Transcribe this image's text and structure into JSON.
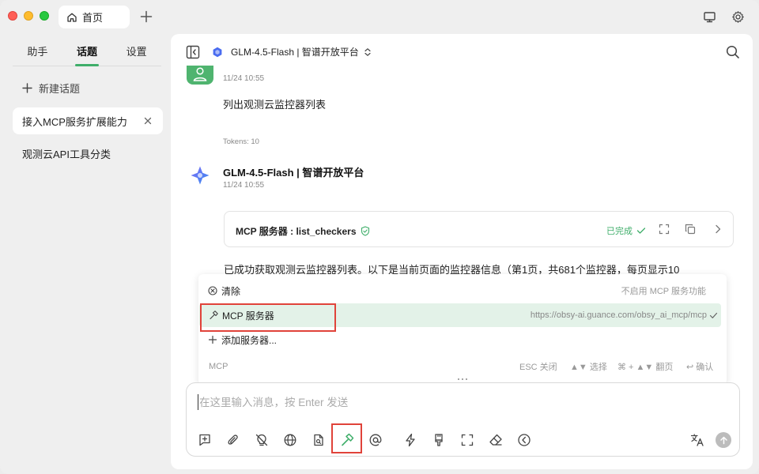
{
  "titlebar": {
    "tab_label": "首页"
  },
  "sidebar": {
    "tabs": [
      {
        "label": "助手"
      },
      {
        "label": "话题"
      },
      {
        "label": "设置"
      }
    ],
    "new_topic_label": "新建话题",
    "topics": [
      {
        "label": "接入MCP服务扩展能力"
      },
      {
        "label": "观测云API工具分类"
      }
    ]
  },
  "header": {
    "model_label": "GLM-4.5-Flash | 智谱开放平台"
  },
  "messages": {
    "user": {
      "time": "11/24 10:55",
      "text": "列出观测云监控器列表",
      "tokens": "Tokens: 10"
    },
    "bot": {
      "name": "GLM-4.5-Flash | 智谱开放平台",
      "time": "11/24 10:55",
      "tool_card": {
        "title": "MCP 服务器 : list_checkers",
        "status": "已完成"
      },
      "reply": "已成功获取观测云监控器列表。以下是当前页面的监控器信息（第1页，共681个监控器，每页显示10"
    }
  },
  "popup": {
    "items": [
      {
        "label": "清除",
        "hint": "不启用 MCP 服务功能"
      },
      {
        "label": "MCP 服务器",
        "hint": "https://obsy-ai.guance.com/obsy_ai_mcp/mcp"
      },
      {
        "label": "添加服务器..."
      }
    ],
    "footer": {
      "source": "MCP",
      "esc": "ESC 关闭",
      "select": "▲▼ 选择",
      "page": "⌘ + ▲▼ 翻页",
      "confirm": "↩ 确认"
    }
  },
  "input": {
    "placeholder": "在这里输入消息，按 Enter 发送",
    "value": ""
  },
  "colors": {
    "accent": "#3fae6a",
    "highlight_box": "#e0433a",
    "selected_row": "#e3f2e8"
  }
}
